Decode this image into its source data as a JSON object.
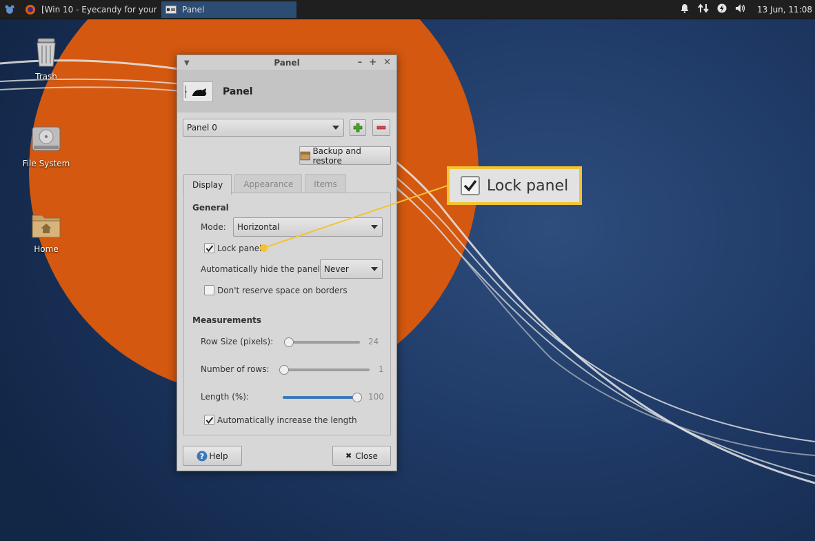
{
  "taskbar": {
    "tasks": [
      {
        "label": "[Win 10 - Eyecandy for your ..."
      },
      {
        "label": "Panel"
      }
    ],
    "clock": "13 Jun, 11:08"
  },
  "desktop": {
    "icons": [
      {
        "label": "Trash"
      },
      {
        "label": "File System"
      },
      {
        "label": "Home"
      }
    ]
  },
  "dialog": {
    "window_title": "Panel",
    "header_title": "Panel",
    "panel_select": "Panel 0",
    "backup_label": "Backup and restore",
    "tabs": [
      {
        "label": "Display",
        "active": true
      },
      {
        "label": "Appearance",
        "active": false
      },
      {
        "label": "Items",
        "active": false
      }
    ],
    "general": {
      "title": "General",
      "mode_label": "Mode:",
      "mode_value": "Horizontal",
      "lock_panel_label": "Lock panel",
      "lock_panel_checked": true,
      "autohide_label": "Automatically hide the panel:",
      "autohide_value": "Never",
      "reserve_label": "Don't reserve space on borders",
      "reserve_checked": false
    },
    "measurements": {
      "title": "Measurements",
      "row_size_label": "Row Size (pixels):",
      "row_size_value": "24",
      "rows_label": "Number of rows:",
      "rows_value": "1",
      "length_label": "Length (%):",
      "length_value": "100",
      "auto_increase_label": "Automatically increase the length",
      "auto_increase_checked": true
    },
    "help_label": "Help",
    "close_label": "Close"
  },
  "callout": {
    "label": "Lock panel"
  },
  "colors": {
    "callout_border": "#f3c332",
    "desktop_orange": "#d4580f",
    "desktop_blue": "#1f3a66",
    "active_task": "#2b4c73",
    "slider_fill": "#3d79b8"
  }
}
